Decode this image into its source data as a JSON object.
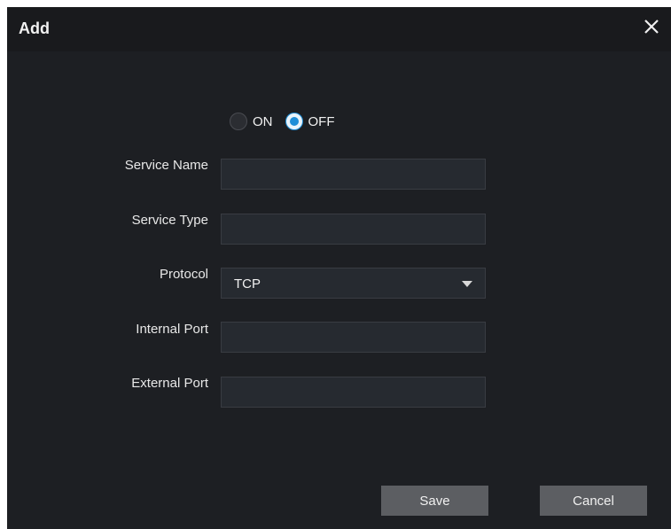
{
  "dialog": {
    "title": "Add",
    "close_icon": "close-icon"
  },
  "enable": {
    "options": [
      {
        "label": "ON",
        "selected": false
      },
      {
        "label": "OFF",
        "selected": true
      }
    ]
  },
  "form": {
    "service_name": {
      "label": "Service Name",
      "value": ""
    },
    "service_type": {
      "label": "Service Type",
      "value": ""
    },
    "protocol": {
      "label": "Protocol",
      "value": "TCP"
    },
    "internal_port": {
      "label": "Internal Port",
      "value": ""
    },
    "external_port": {
      "label": "External Port",
      "value": ""
    }
  },
  "buttons": {
    "save": "Save",
    "cancel": "Cancel"
  },
  "colors": {
    "background": "#1d1f23",
    "accent": "#1e8ed8",
    "button": "#5c5e62"
  }
}
